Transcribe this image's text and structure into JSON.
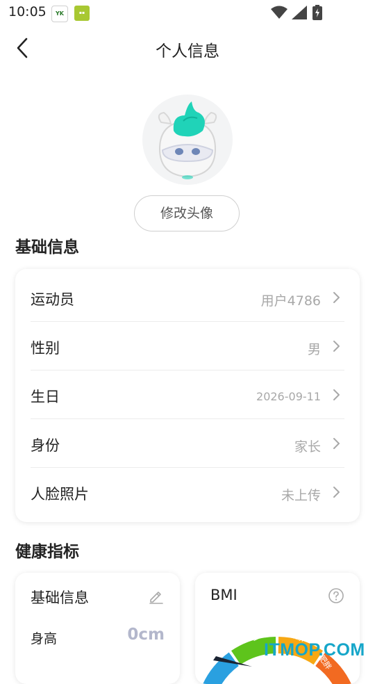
{
  "status_bar": {
    "time": "10:05",
    "icons": [
      "app-notification-icon",
      "app-notification-icon-2",
      "wifi-icon",
      "signal-icon",
      "battery-charging-icon"
    ]
  },
  "header": {
    "title": "个人信息",
    "back_icon": "chevron-left-icon"
  },
  "avatar": {
    "icon": "unicorn-mascot-avatar",
    "edit_label": "修改头像"
  },
  "basic_info": {
    "section_title": "基础信息",
    "rows": [
      {
        "label": "运动员",
        "value": "用户4786"
      },
      {
        "label": "性别",
        "value": "男"
      },
      {
        "label": "生日",
        "value": "2026-09-11"
      },
      {
        "label": "身份",
        "value": "家长"
      },
      {
        "label": "人脸照片",
        "value": "未上传"
      }
    ]
  },
  "health": {
    "section_title": "健康指标",
    "basic_card": {
      "title": "基础信息",
      "edit_icon": "pencil-icon",
      "height_label": "身高",
      "height_value": "0cm"
    },
    "bmi_card": {
      "title": "BMI",
      "help_icon": "question-circle-icon",
      "gauge_labels": [
        "正常",
        "偏胖",
        "肥胖"
      ],
      "gauge_colors": [
        "#2aa0e0",
        "#5ec41c",
        "#f7a814",
        "#f26a21"
      ]
    }
  },
  "watermark": "ITMOP.COM",
  "colors": {
    "value_text": "#a8a8a8",
    "height_value": "#b3b7cc",
    "mascot_accent": "#20d3b8"
  }
}
